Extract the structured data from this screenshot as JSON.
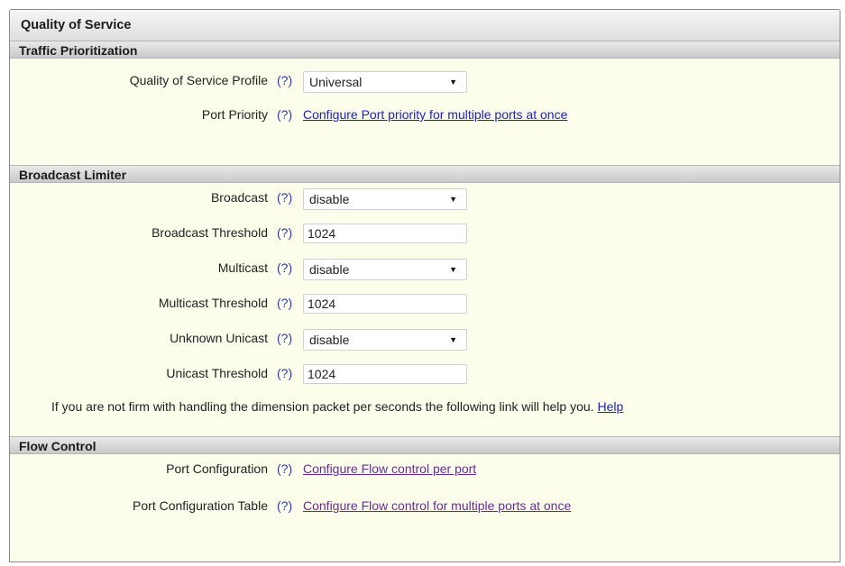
{
  "panel": {
    "title": "Quality of Service"
  },
  "traffic": {
    "heading": "Traffic Prioritization",
    "qos_profile": {
      "label": "Quality of Service Profile",
      "help": "(?)",
      "value": "Universal"
    },
    "port_priority": {
      "label": "Port Priority",
      "help": "(?)",
      "link": "Configure Port priority for multiple ports at once"
    }
  },
  "broadcast": {
    "heading": "Broadcast Limiter",
    "broadcast": {
      "label": "Broadcast",
      "help": "(?)",
      "value": "disable"
    },
    "broadcast_threshold": {
      "label": "Broadcast Threshold",
      "help": "(?)",
      "value": "1024"
    },
    "multicast": {
      "label": "Multicast",
      "help": "(?)",
      "value": "disable"
    },
    "multicast_threshold": {
      "label": "Multicast Threshold",
      "help": "(?)",
      "value": "1024"
    },
    "unknown_unicast": {
      "label": "Unknown Unicast",
      "help": "(?)",
      "value": "disable"
    },
    "unicast_threshold": {
      "label": "Unicast Threshold",
      "help": "(?)",
      "value": "1024"
    },
    "note": "If you are not firm with handling the dimension packet per seconds the following link will help you.",
    "help_link": "Help"
  },
  "flow": {
    "heading": "Flow Control",
    "port_config": {
      "label": "Port Configuration",
      "help": "(?)",
      "link": "Configure Flow control per port"
    },
    "port_config_table": {
      "label": "Port Configuration Table",
      "help": "(?)",
      "link": "Configure Flow control for multiple ports at once"
    }
  },
  "icons": {
    "select_arrow": "triangle-down-icon"
  },
  "colors": {
    "panel_bg": "#fdfdec",
    "help_text": "#2b39b4",
    "link": "#2020c0",
    "visited_link": "#6a2a9a"
  }
}
